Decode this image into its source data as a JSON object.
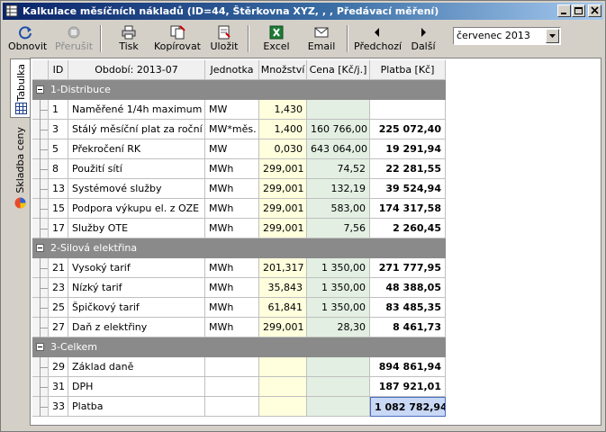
{
  "window": {
    "title": "Kalkulace měsíčních nákladů (ID=44, Štěrkovna XYZ, , , Předávací měření)",
    "controls": {
      "minimize": "minimize",
      "maximize": "maximize",
      "close": "close"
    }
  },
  "toolbar": {
    "refresh": "Obnovit",
    "interrupt": "Přerušit",
    "print": "Tisk",
    "copy": "Kopírovat",
    "save": "Uložit",
    "excel": "Excel",
    "email": "Email",
    "previous": "Předchozí",
    "next": "Další",
    "month": "červenec 2013"
  },
  "tabs": {
    "table": "Tabulka",
    "composition": "Skladba ceny"
  },
  "columns": {
    "id": "ID",
    "period": "Období: 2013-07",
    "unit": "Jednotka",
    "quantity": "Množství",
    "price": "Cena [Kč/j.]",
    "payment": "Platba [Kč]"
  },
  "groups": [
    {
      "label": "1-Distribuce",
      "rows": [
        {
          "id": "1",
          "name": "Naměřené 1/4h maximum",
          "unit": "MW",
          "qty": "1,430",
          "price": "",
          "pay": ""
        },
        {
          "id": "3",
          "name": "Stálý měsíční plat za roční RK",
          "unit": "MW*měs.",
          "qty": "1,400",
          "price": "160 766,00",
          "pay": "225 072,40"
        },
        {
          "id": "5",
          "name": "Překročení RK",
          "unit": "MW",
          "qty": "0,030",
          "price": "643 064,00",
          "pay": "19 291,94"
        },
        {
          "id": "8",
          "name": "Použití sítí",
          "unit": "MWh",
          "qty": "299,001",
          "price": "74,52",
          "pay": "22 281,55"
        },
        {
          "id": "13",
          "name": "Systémové služby",
          "unit": "MWh",
          "qty": "299,001",
          "price": "132,19",
          "pay": "39 524,94"
        },
        {
          "id": "15",
          "name": "Podpora výkupu el. z OZE",
          "unit": "MWh",
          "qty": "299,001",
          "price": "583,00",
          "pay": "174 317,58"
        },
        {
          "id": "17",
          "name": "Služby OTE",
          "unit": "MWh",
          "qty": "299,001",
          "price": "7,56",
          "pay": "2 260,45"
        }
      ]
    },
    {
      "label": "2-Silová elektřina",
      "rows": [
        {
          "id": "21",
          "name": "Vysoký tarif",
          "unit": "MWh",
          "qty": "201,317",
          "price": "1 350,00",
          "pay": "271 777,95"
        },
        {
          "id": "23",
          "name": "Nízký tarif",
          "unit": "MWh",
          "qty": "35,843",
          "price": "1 350,00",
          "pay": "48 388,05"
        },
        {
          "id": "25",
          "name": "Špičkový tarif",
          "unit": "MWh",
          "qty": "61,841",
          "price": "1 350,00",
          "pay": "83 485,35"
        },
        {
          "id": "27",
          "name": "Daň z elektřiny",
          "unit": "MWh",
          "qty": "299,001",
          "price": "28,30",
          "pay": "8 461,73"
        }
      ]
    },
    {
      "label": "3-Celkem",
      "rows": [
        {
          "id": "29",
          "name": "Základ daně",
          "unit": "",
          "qty": "",
          "price": "",
          "pay": "894 861,94"
        },
        {
          "id": "31",
          "name": "DPH",
          "unit": "",
          "qty": "",
          "price": "",
          "pay": "187 921,01"
        },
        {
          "id": "33",
          "name": "Platba",
          "unit": "",
          "qty": "",
          "price": "",
          "pay": "1 082 782,94"
        }
      ]
    }
  ]
}
